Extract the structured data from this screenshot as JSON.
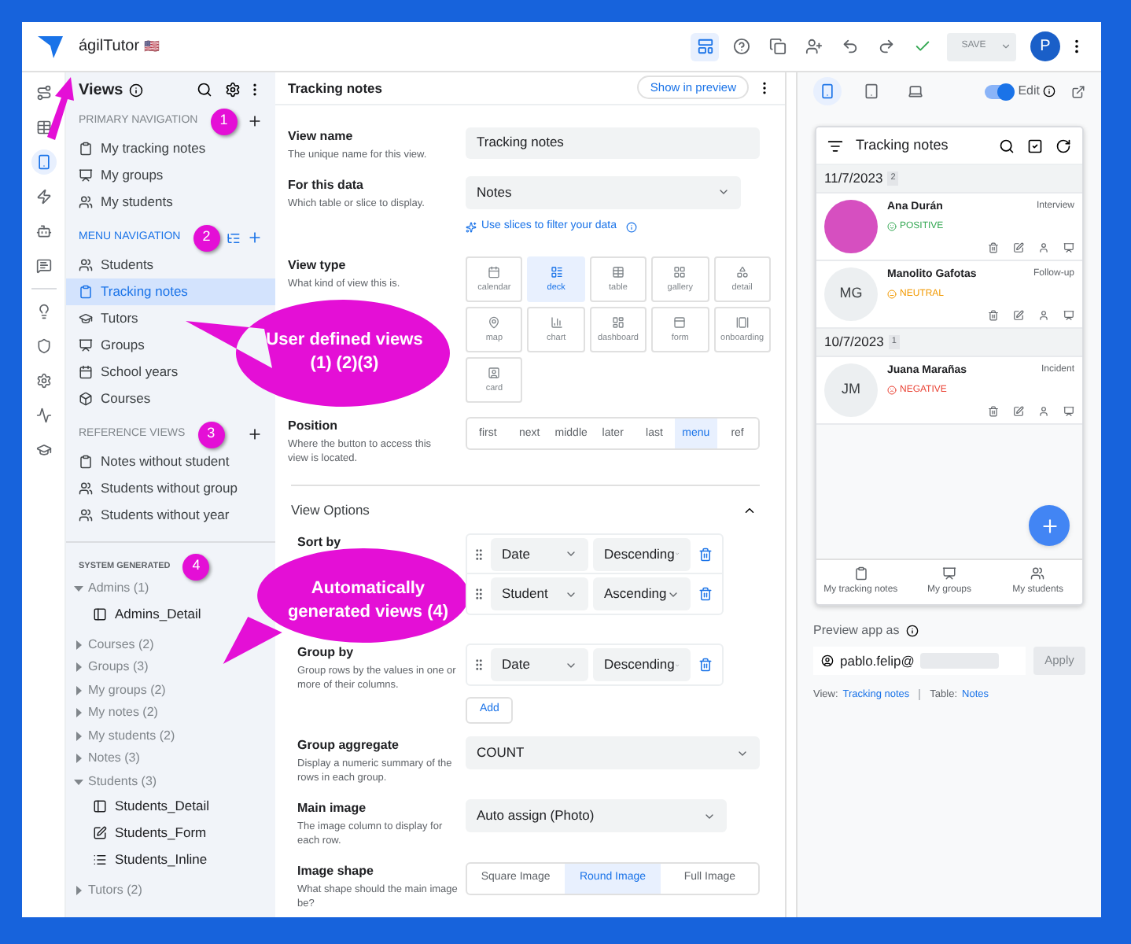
{
  "app": {
    "name": "ágilTutor",
    "flag": "🇺🇸"
  },
  "toolbar": [
    {
      "kind": "layout",
      "selected": true
    },
    {
      "kind": "help",
      "selected": false
    },
    {
      "kind": "copy",
      "selected": false
    },
    {
      "kind": "user-plus",
      "selected": false
    },
    {
      "kind": "undo",
      "selected": false
    },
    {
      "kind": "redo",
      "selected": false
    },
    {
      "kind": "check",
      "selected": false
    }
  ],
  "save": {
    "label": "SAVE",
    "disabled": true
  },
  "avatar": "P",
  "rail": [
    {
      "kind": "route",
      "selected": false
    },
    {
      "kind": "table",
      "selected": false
    },
    {
      "kind": "phone",
      "selected": true
    },
    {
      "kind": "bolt",
      "selected": false
    },
    {
      "kind": "bot",
      "selected": false
    },
    {
      "kind": "chat",
      "selected": false
    },
    {
      "kind": "bulb",
      "selected": false
    },
    {
      "kind": "shield",
      "selected": false
    },
    {
      "kind": "settings",
      "selected": false
    },
    {
      "kind": "chart",
      "selected": false
    },
    {
      "kind": "cap",
      "selected": false
    }
  ],
  "sidebar": {
    "title": "Views",
    "sections": [
      {
        "title": "PRIMARY NAVIGATION",
        "highlighted": false,
        "marker": "1",
        "items": [
          {
            "kind": "clipboard",
            "label": "My tracking notes",
            "selected": false
          },
          {
            "kind": "board",
            "label": "My groups",
            "selected": false
          },
          {
            "kind": "users",
            "label": "My students",
            "selected": false
          }
        ]
      },
      {
        "title": "MENU NAVIGATION",
        "highlighted": true,
        "marker": "2",
        "items": [
          {
            "kind": "users",
            "label": "Students",
            "selected": false
          },
          {
            "kind": "clipboard",
            "label": "Tracking notes",
            "selected": true
          },
          {
            "kind": "cap",
            "label": "Tutors",
            "selected": false
          },
          {
            "kind": "board",
            "label": "Groups",
            "selected": false
          },
          {
            "kind": "calendar",
            "label": "School years",
            "selected": false
          },
          {
            "kind": "cube",
            "label": "Courses",
            "selected": false
          }
        ]
      },
      {
        "title": "REFERENCE VIEWS",
        "highlighted": false,
        "marker": "3",
        "items": [
          {
            "kind": "clipboard",
            "label": "Notes without student",
            "selected": false
          },
          {
            "kind": "users",
            "label": "Students without group",
            "selected": false
          },
          {
            "kind": "users",
            "label": "Students without year",
            "selected": false
          }
        ]
      }
    ],
    "system": {
      "title": "SYSTEM GENERATED",
      "marker": "4",
      "groups": [
        {
          "label": "Admins (1)",
          "expanded": true,
          "children": [
            {
              "kind": "detail",
              "label": "Admins_Detail"
            }
          ]
        },
        {
          "label": "Courses (2)",
          "expanded": false
        },
        {
          "label": "Groups (3)",
          "expanded": false
        },
        {
          "label": "My groups (2)",
          "expanded": false
        },
        {
          "label": "My notes (2)",
          "expanded": false
        },
        {
          "label": "My students (2)",
          "expanded": false
        },
        {
          "label": "Notes (3)",
          "expanded": false
        },
        {
          "label": "Students (3)",
          "expanded": true,
          "children": [
            {
              "kind": "detail",
              "label": "Students_Detail"
            },
            {
              "kind": "form",
              "label": "Students_Form"
            },
            {
              "kind": "list",
              "label": "Students_Inline"
            }
          ]
        },
        {
          "label": "Tutors (2)",
          "expanded": false
        }
      ]
    }
  },
  "editor": {
    "title": "Tracking notes",
    "preview_button": "Show in preview",
    "view_name": {
      "label": "View name",
      "hint": "The unique name for this view.",
      "value": "Tracking notes"
    },
    "data": {
      "label": "For this data",
      "hint": "Which table or slice to display.",
      "value": "Notes",
      "link": "Use slices to filter your data"
    },
    "view_type": {
      "label": "View type",
      "hint": "What kind of view this is.",
      "options": [
        {
          "kind": "calendar",
          "label": "calendar",
          "selected": false
        },
        {
          "kind": "deck",
          "label": "deck",
          "selected": true
        },
        {
          "kind": "table",
          "label": "table",
          "selected": false
        },
        {
          "kind": "gallery",
          "label": "gallery",
          "selected": false
        },
        {
          "kind": "detail",
          "label": "detail",
          "selected": false
        },
        {
          "kind": "map",
          "label": "map",
          "selected": false
        },
        {
          "kind": "chart",
          "label": "chart",
          "selected": false
        },
        {
          "kind": "dashboard",
          "label": "dashboard",
          "selected": false
        },
        {
          "kind": "form",
          "label": "form",
          "selected": false
        },
        {
          "kind": "onboarding",
          "label": "onboarding",
          "selected": false
        },
        {
          "kind": "card",
          "label": "card",
          "selected": false
        }
      ]
    },
    "position": {
      "label": "Position",
      "hint": "Where the button to access this view is located.",
      "options": [
        {
          "label": "first",
          "selected": false
        },
        {
          "label": "next",
          "selected": false
        },
        {
          "label": "middle",
          "selected": false
        },
        {
          "label": "later",
          "selected": false
        },
        {
          "label": "last",
          "selected": false
        },
        {
          "label": "menu",
          "selected": true
        },
        {
          "label": "ref",
          "selected": false
        }
      ]
    },
    "view_options": {
      "title": "View Options",
      "expanded": true,
      "sort_by": {
        "label": "Sort by",
        "rows": [
          {
            "column": "Date",
            "order": "Descending"
          },
          {
            "column": "Student",
            "order": "Ascending"
          }
        ]
      },
      "group_by": {
        "label": "Group by",
        "hint": "Group rows by the values in one or more of their columns.",
        "rows": [
          {
            "column": "Date",
            "order": "Descending"
          }
        ],
        "add": "Add"
      },
      "group_aggregate": {
        "label": "Group aggregate",
        "hint": "Display a numeric summary of the rows in each group.",
        "value": "COUNT"
      },
      "main_image": {
        "label": "Main image",
        "hint": "The image column to display for each row.",
        "value": "Auto assign (Photo)"
      },
      "image_shape": {
        "label": "Image shape",
        "hint": "What shape should the main image be?",
        "options": [
          {
            "label": "Square Image",
            "selected": false
          },
          {
            "label": "Round Image",
            "selected": true
          },
          {
            "label": "Full Image",
            "selected": false
          }
        ]
      }
    }
  },
  "preview": {
    "devices": [
      {
        "kind": "phone",
        "selected": true
      },
      {
        "kind": "tablet",
        "selected": false
      },
      {
        "kind": "laptop",
        "selected": false
      }
    ],
    "edit": {
      "label": "Edit",
      "on": true
    },
    "screen": {
      "title": "Tracking notes",
      "groups": [
        {
          "date": "11/7/2023",
          "count": "2",
          "items": [
            {
              "photo": true,
              "name": "Ana Durán",
              "kind": "positive",
              "status": "POSITIVE",
              "type": "Interview"
            },
            {
              "photo": false,
              "initials": "MG",
              "name": "Manolito Gafotas",
              "kind": "neutral",
              "status": "NEUTRAL",
              "type": "Follow-up"
            }
          ]
        },
        {
          "date": "10/7/2023",
          "count": "1",
          "items": [
            {
              "photo": false,
              "initials": "JM",
              "name": "Juana Marañas",
              "kind": "negative",
              "status": "NEGATIVE",
              "type": "Incident"
            }
          ]
        }
      ],
      "nav": [
        {
          "kind": "clipboard",
          "label": "My tracking notes"
        },
        {
          "kind": "board",
          "label": "My groups"
        },
        {
          "kind": "users",
          "label": "My students"
        }
      ]
    },
    "preview_as": {
      "label": "Preview app as",
      "value": "pablo.felip@",
      "apply": "Apply",
      "apply_disabled": true
    },
    "footer": {
      "view_label": "View:",
      "view": "Tracking notes",
      "table_label": "Table:",
      "table": "Notes"
    }
  },
  "annotations": [
    {
      "kind": "bubble",
      "text": "User defined views (1) (2)(3)"
    },
    {
      "kind": "bubble",
      "text": "Automatically generated views (4)"
    }
  ]
}
